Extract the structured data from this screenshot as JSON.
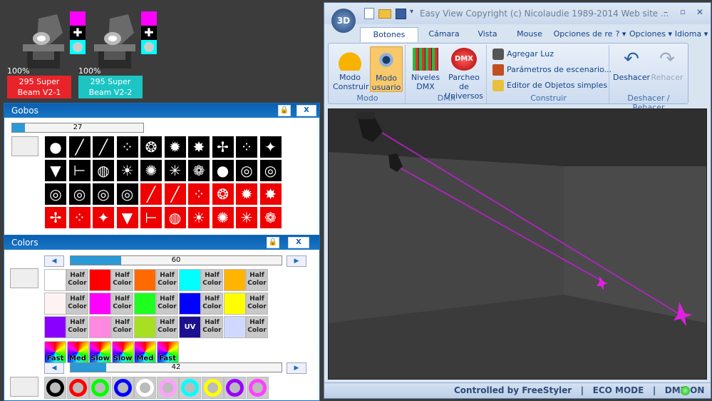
{
  "fixtures": [
    {
      "pct": "100%",
      "label": "295 Super Beam V2-1",
      "label_color": "#e8242a"
    },
    {
      "pct": "100%",
      "label": "295 Super Beam V2-2",
      "label_color": "#1cc4c4"
    }
  ],
  "gobos_panel": {
    "title": "Gobos",
    "lock_icon": "lock-icon",
    "close_label": "X",
    "slider_value": "27",
    "slider_fraction": 0.1
  },
  "colors_panel": {
    "title": "Colors",
    "lock_icon": "lock-icon",
    "close_label": "X",
    "slider1_value": "60",
    "slider1_fraction": 0.24,
    "slider2_value": "42",
    "slider2_fraction": 0.17,
    "half_label": "Half\nColor",
    "uv_label": "UV",
    "color_rows": [
      [
        "#ffffff",
        "#ff0000",
        "#ff6a00",
        "#00ffff",
        "#ffb400"
      ],
      [
        "#fff2f2",
        "#ff00ff",
        "#1fff1f",
        "#0000ff",
        "#ffff00"
      ],
      [
        "#8a00ff",
        "#ff88e0",
        "#a7e023",
        "UV",
        "#d0d8ff"
      ]
    ],
    "speed_labels": [
      "Fast",
      "Med",
      "Slow",
      "Slow",
      "Med",
      "Fast"
    ],
    "ring_colors": [
      "#000000",
      "#ff0000",
      "#00ff00",
      "#0000ff",
      "#ffffff",
      "#ffa0ff",
      "#00ffff",
      "#ffff00",
      "#9a00ff",
      "#ff40ff"
    ]
  },
  "window": {
    "title": "Easy View  Copyright (c) Nicolaudie 1989-2014    Web site ...",
    "app_logo": "3D",
    "tabs": [
      "Botones estánd",
      "Cámara",
      "Vista",
      "Mouse",
      "Opciones de re"
    ],
    "right_tabs": [
      "? ▾",
      "Opciones ▾",
      "Idioma ▾"
    ],
    "groups": {
      "modo": {
        "label": "Modo",
        "buttons": [
          "Modo\nConstruir",
          "Modo\nusuario"
        ]
      },
      "dmx": {
        "label": "DMX",
        "buttons": [
          "Niveles\nDMX",
          "Parcheo de\nUniversos"
        ]
      },
      "construir": {
        "label": "Construir",
        "items": [
          "Agregar Luz",
          "Parámetros de escenario...",
          "Editor de Objetos simples"
        ]
      },
      "undo": {
        "label": "Deshacer / Rehacer",
        "buttons": [
          "Deshacer",
          "Rehacer"
        ]
      }
    },
    "dmx_icon_text": "DMX",
    "status": "Controlled by FreeStyler   |   ECO MODE   |   DMX ON"
  }
}
